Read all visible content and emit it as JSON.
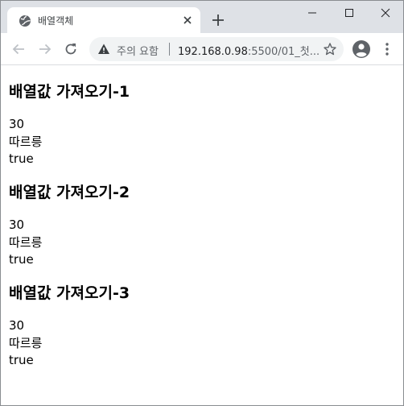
{
  "window": {
    "tab": {
      "title": "배열객체"
    },
    "controls": {
      "minimize": "minimize",
      "maximize": "maximize",
      "close": "close"
    }
  },
  "toolbar": {
    "security_label": "주의 요함",
    "url_host": "192.168.0.98",
    "url_rest": ":5500/01_첫..."
  },
  "sections": [
    {
      "heading": "배열값 가져오기-1",
      "lines": [
        "30",
        "따르릉",
        "true"
      ]
    },
    {
      "heading": "배열값 가져오기-2",
      "lines": [
        "30",
        "따르릉",
        "true"
      ]
    },
    {
      "heading": "배열값 가져오기-3",
      "lines": [
        "30",
        "따르릉",
        "true"
      ]
    }
  ],
  "colors": {
    "titlebar": "#dee1e6",
    "omnibox": "#f1f3f4",
    "icon": "#5f6368"
  }
}
